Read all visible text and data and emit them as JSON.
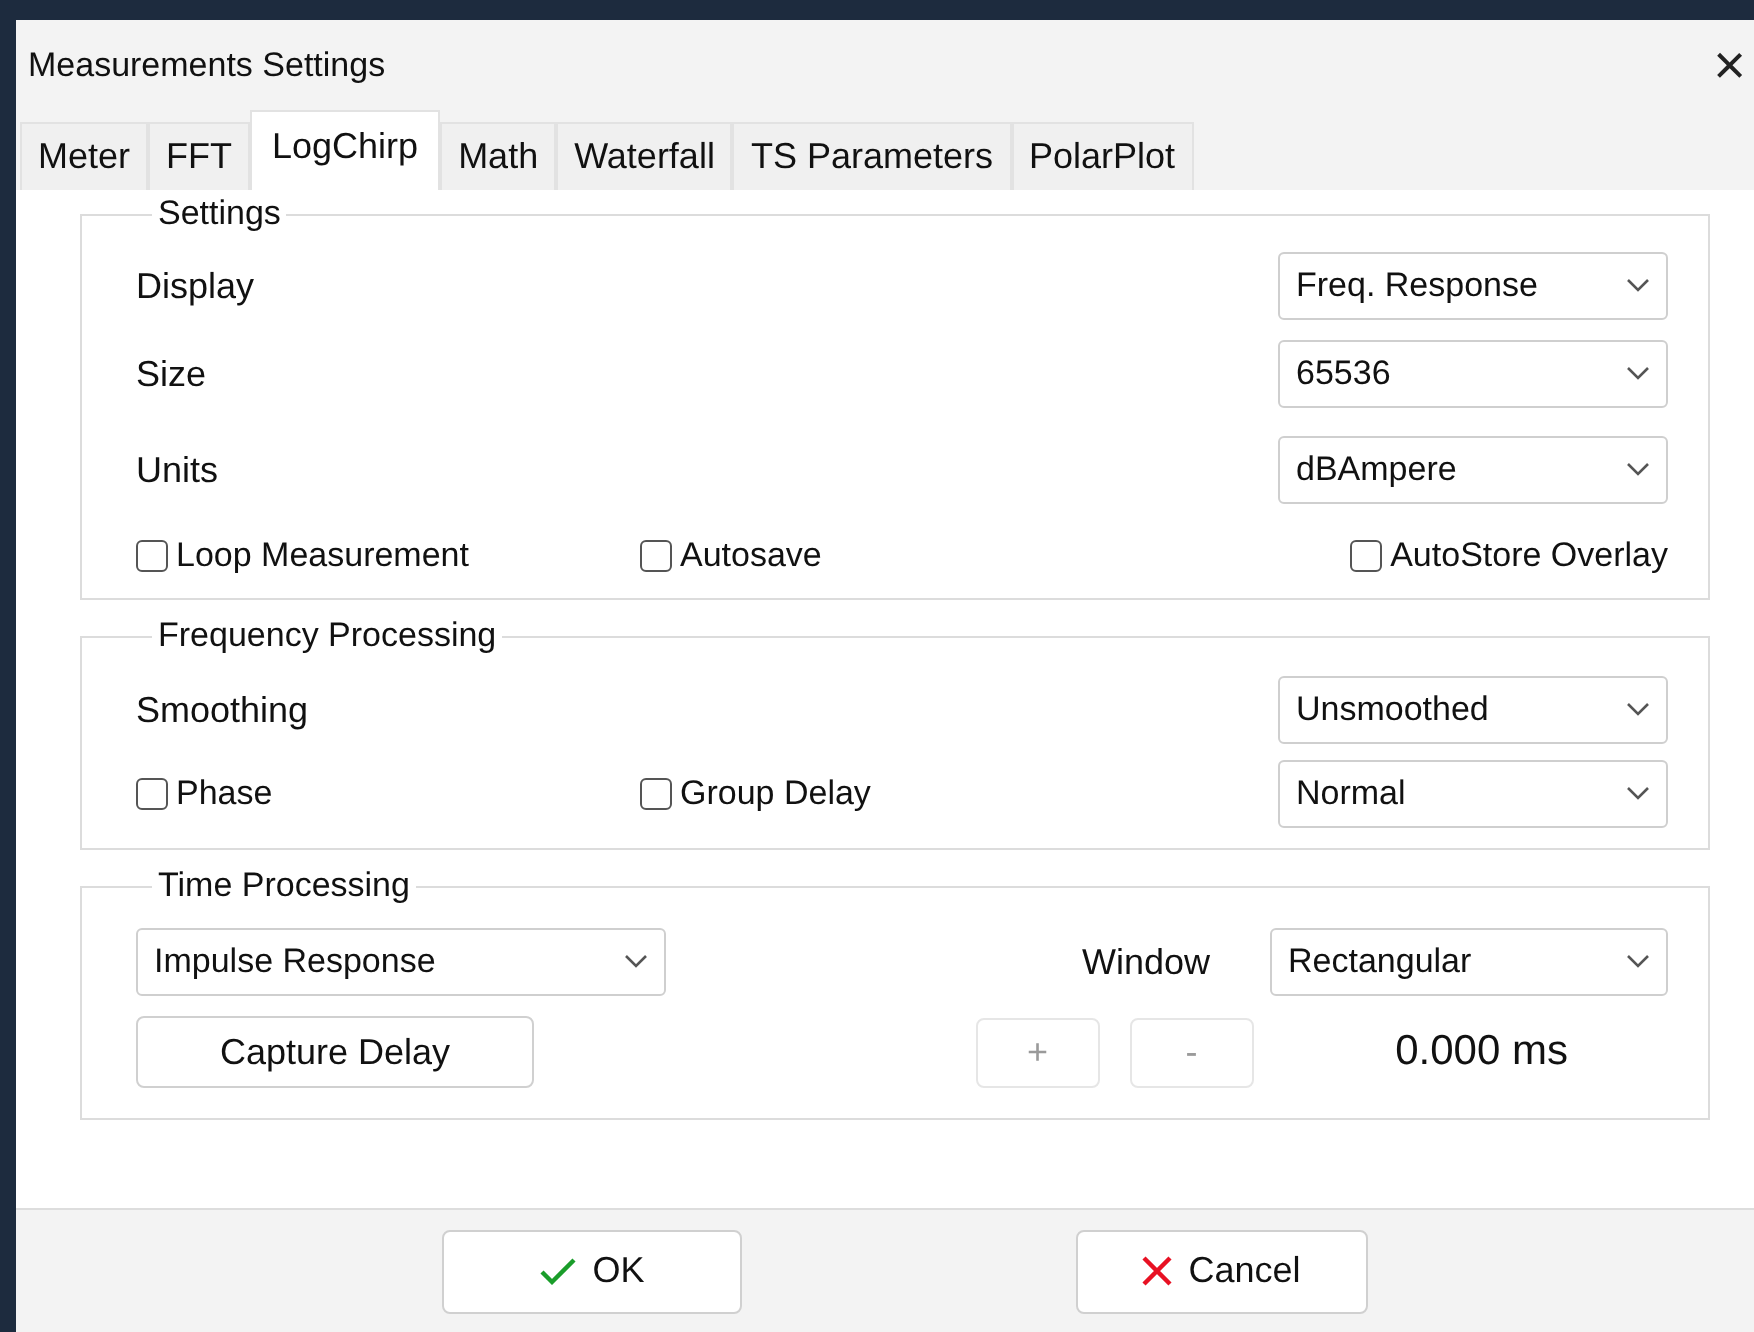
{
  "window": {
    "title": "Measurements Settings",
    "close": "×"
  },
  "tabs": [
    {
      "label": "Meter",
      "selected": false
    },
    {
      "label": "FFT",
      "selected": false
    },
    {
      "label": "LogChirp",
      "selected": true
    },
    {
      "label": "Math",
      "selected": false
    },
    {
      "label": "Waterfall",
      "selected": false
    },
    {
      "label": "TS Parameters",
      "selected": false
    },
    {
      "label": "PolarPlot",
      "selected": false
    }
  ],
  "settings": {
    "title": "Settings",
    "rows": [
      {
        "label": "Display",
        "value": "Freq. Response"
      },
      {
        "label": "Size",
        "value": "65536"
      },
      {
        "label": "Units",
        "value": "dBAmpere"
      }
    ],
    "checkboxes": [
      {
        "label": "Loop Measurement",
        "checked": false
      },
      {
        "label": "Autosave",
        "checked": false
      },
      {
        "label": "AutoStore Overlay",
        "checked": false
      }
    ]
  },
  "frequency_processing": {
    "title": "Frequency Processing",
    "smoothing": {
      "label": "Smoothing",
      "value": "Unsmoothed"
    },
    "checkboxes": [
      {
        "label": "Phase",
        "checked": false
      },
      {
        "label": "Group Delay",
        "checked": false
      }
    ],
    "mode": {
      "value": "Normal"
    }
  },
  "time_processing": {
    "title": "Time Processing",
    "response": {
      "value": "Impulse Response"
    },
    "window": {
      "label": "Window",
      "value": "Rectangular"
    },
    "capture_button": {
      "label": "Capture Delay",
      "disabled": false
    },
    "step_buttons": [
      {
        "label": "+",
        "disabled": true
      },
      {
        "label": "-",
        "disabled": true
      }
    ],
    "delay": "0.000 ms"
  },
  "buttons": [
    {
      "kind": "ok",
      "label": "OK"
    },
    {
      "kind": "cancel",
      "label": "Cancel"
    }
  ]
}
